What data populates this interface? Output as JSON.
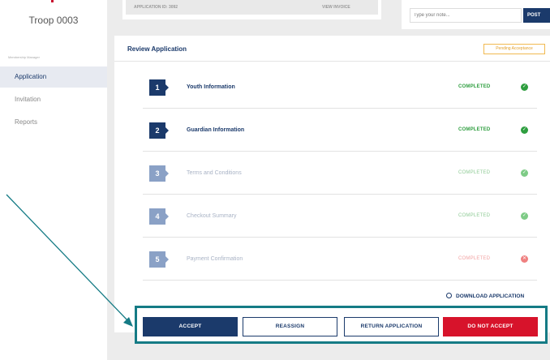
{
  "sidebar": {
    "troop": "Troop 0003",
    "caption": "Membership Manager",
    "items": [
      {
        "label": "Application",
        "active": true
      },
      {
        "label": "Invitation",
        "active": false
      },
      {
        "label": "Reports",
        "active": false
      }
    ]
  },
  "header": {
    "application_no": "APPLICATION ID: 3092",
    "view_invoice": "VIEW INVOICE",
    "note_placeholder": "Type your note...",
    "post_label": "POST"
  },
  "review": {
    "title": "Review Application",
    "badge": "Pending Acceptance",
    "steps": [
      {
        "number": "1",
        "label": "Youth Information",
        "status": "COMPLETED",
        "icon": "check-icon"
      },
      {
        "number": "2",
        "label": "Guardian Information",
        "status": "COMPLETED",
        "icon": "check-icon"
      },
      {
        "number": "3",
        "label": "Terms and Conditions",
        "status": "COMPLETED",
        "icon": "check-icon"
      },
      {
        "number": "4",
        "label": "Checkout Summary",
        "status": "COMPLETED",
        "icon": "check-icon"
      },
      {
        "number": "5",
        "label": "Payment Confirmation",
        "status": "COMPLETED",
        "icon": "error-icon"
      }
    ],
    "download": "DOWNLOAD APPLICATION"
  },
  "actions": {
    "accept": "ACCEPT",
    "reassign": "REASSIGN",
    "return": "RETURN APPLICATION",
    "reject": "DO NOT ACCEPT"
  },
  "colors": {
    "primary": "#1b3a6b",
    "success": "#2e9e3f",
    "danger": "#d7132b",
    "highlight": "#157b85",
    "warning": "#e3a02b"
  }
}
